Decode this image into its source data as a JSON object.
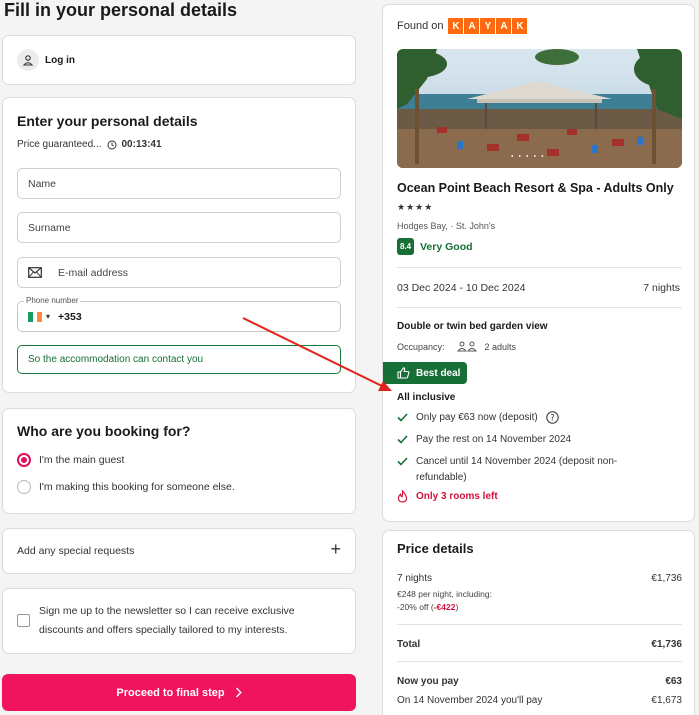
{
  "page_title": "Fill in your personal details",
  "login": {
    "label": "Log in"
  },
  "details": {
    "title": "Enter your personal details",
    "price_guaranteed": "Price guaranteed...",
    "timer": "00:13:41",
    "name_placeholder": "Name",
    "surname_placeholder": "Surname",
    "email_placeholder": "E-mail address",
    "phone_label": "Phone number",
    "phone_prefix": "+353",
    "hint": "So the accommodation can contact you"
  },
  "who": {
    "title": "Who are you booking for?",
    "option_main": "I'm the main guest",
    "option_other": "I'm making this booking for someone else."
  },
  "special_requests": "Add any special requests",
  "newsletter": "Sign me up to the newsletter so I can receive exclusive discounts and offers specially tailored to my interests.",
  "proceed": "Proceed to final step",
  "hotel": {
    "found_on": "Found on",
    "kayak_letters": [
      "K",
      "A",
      "Y",
      "A",
      "K"
    ],
    "photo_dots": "● ● ● ● ●",
    "name": "Ocean Point Beach Resort & Spa - Adults Only",
    "stars": "★★★★",
    "address": "Hodges Bay, · St. John's",
    "rating_score": "8.4",
    "rating_text": "Very Good",
    "dates": "03 Dec 2024 - 10 Dec 2024",
    "nights": "7 nights",
    "room_type": "Double or twin bed garden view",
    "occupancy_label": "Occupancy:",
    "occupancy_value": "2 adults",
    "best_deal": "Best deal",
    "board": "All inclusive",
    "feature_deposit": "Only pay €63 now (deposit)",
    "feature_rest": "Pay the rest on 14 November 2024",
    "feature_cancel": "Cancel until 14 November 2024 (deposit non-refundable)",
    "rooms_left": "Only 3 rooms left"
  },
  "price": {
    "title": "Price details",
    "nights_label": "7 nights",
    "nights_value": "€1,736",
    "per_night": "€248 per night, including:",
    "discount_label": "-20% off (",
    "discount_value": "-€422",
    "discount_close": ")",
    "total_label": "Total",
    "total_value": "€1,736",
    "now_label": "Now you pay",
    "now_value": "€63",
    "later_label": "On 14 November 2024 you'll pay",
    "later_value": "€1,673"
  },
  "colors": {
    "accent_pink": "#f0135d",
    "green": "#176f37",
    "red": "#d2123c",
    "kayak_orange": "#ff690f"
  }
}
